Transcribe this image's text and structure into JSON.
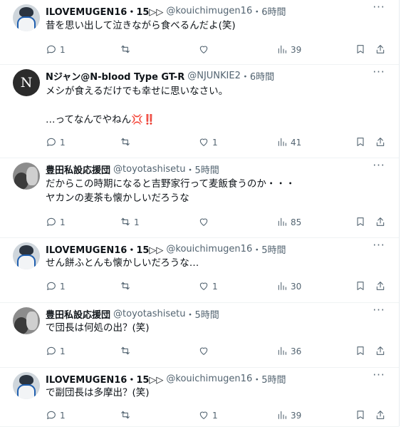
{
  "tweets": [
    {
      "name": "ILOVEMUGEN16・15▷▷",
      "handle": "@kouichimugen16",
      "time": "・6時間",
      "lines": [
        "昔を思い出して泣きながら食べるんだよ(笑)"
      ],
      "reply_count": "1",
      "retweet_count": "",
      "like_count": "",
      "view_count": "39",
      "avatar": "mugen"
    },
    {
      "name": "Nジャン@N-blood Type GT-R",
      "handle": "@NJUNKIE2",
      "time": "・6時間",
      "lines": [
        "メシが食えるだけでも幸せに思いなさい。",
        "",
        "…ってなんでやねん💢‼️"
      ],
      "reply_count": "1",
      "retweet_count": "",
      "like_count": "1",
      "view_count": "41",
      "avatar": "n",
      "avatar_letter": "N"
    },
    {
      "name": "豊田私設応援団",
      "handle": "@toyotashisetu",
      "time": "・5時間",
      "lines": [
        "だからこの時期になると吉野家行って麦飯食うのか・・・",
        "ヤカンの麦茶も懐かしいだろうな"
      ],
      "reply_count": "1",
      "retweet_count": "1",
      "like_count": "",
      "view_count": "85",
      "avatar": "toyo"
    },
    {
      "name": "ILOVEMUGEN16・15▷▷",
      "handle": "@kouichimugen16",
      "time": "・5時間",
      "lines": [
        "せん餅ふとんも懐かしいだろうな…"
      ],
      "reply_count": "1",
      "retweet_count": "",
      "like_count": "1",
      "view_count": "30",
      "avatar": "mugen"
    },
    {
      "name": "豊田私設応援団",
      "handle": "@toyotashisetu",
      "time": "・5時間",
      "lines": [
        "で団長は何処の出？(笑)"
      ],
      "reply_count": "1",
      "retweet_count": "",
      "like_count": "",
      "view_count": "36",
      "avatar": "toyo"
    },
    {
      "name": "ILOVEMUGEN16・15▷▷",
      "handle": "@kouichimugen16",
      "time": "・5時間",
      "lines": [
        "で副団長は多摩出？(笑)"
      ],
      "reply_count": "1",
      "retweet_count": "",
      "like_count": "1",
      "view_count": "39",
      "avatar": "mugen"
    }
  ],
  "icons": {
    "more": "more-icon",
    "reply": "reply-icon",
    "retweet": "retweet-icon",
    "like": "heart-icon",
    "views": "views-icon",
    "bookmark": "bookmark-icon",
    "share": "share-icon"
  },
  "more_label": "···",
  "colors": {
    "text": "#0f1419",
    "secondary": "#536471",
    "divider": "#eff3f4",
    "background": "#ffffff"
  }
}
